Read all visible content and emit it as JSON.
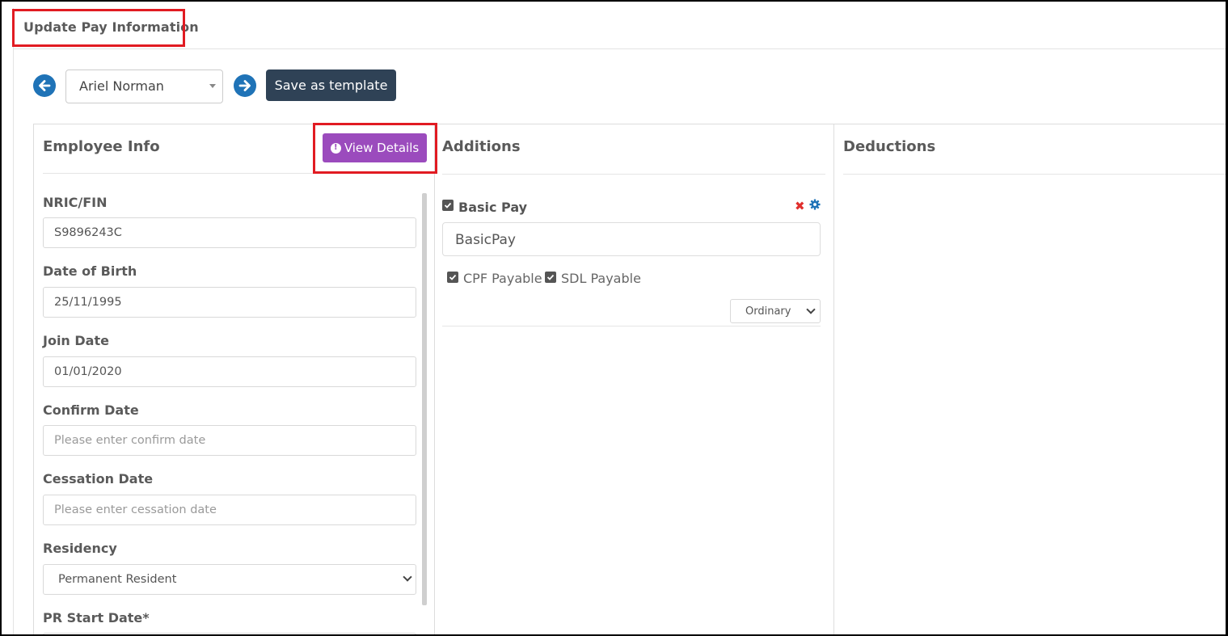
{
  "header": {
    "title": "Update Pay Information"
  },
  "toolbar": {
    "prev_icon": "arrow-left-circle-icon",
    "next_icon": "arrow-right-circle-icon",
    "employee_selected": "Ariel Norman",
    "save_template_label": "Save as template"
  },
  "employee_info": {
    "title": "Employee Info",
    "view_details_label": "View Details",
    "fields": {
      "nric": {
        "label": "NRIC/FIN",
        "value": "S9896243C"
      },
      "dob": {
        "label": "Date of Birth",
        "value": "25/11/1995"
      },
      "join_date": {
        "label": "Join Date",
        "value": "01/01/2020"
      },
      "confirm_date": {
        "label": "Confirm Date",
        "placeholder": "Please enter confirm date"
      },
      "cessation_date": {
        "label": "Cessation Date",
        "placeholder": "Please enter cessation date"
      },
      "residency": {
        "label": "Residency",
        "value": "Permanent Resident"
      },
      "pr_start_date": {
        "label": "PR Start Date*"
      }
    }
  },
  "additions": {
    "title": "Additions",
    "items": [
      {
        "name": "Basic Pay",
        "checked": true,
        "value": "BasicPay",
        "cpf_label": "CPF Payable",
        "cpf_checked": true,
        "sdl_label": "SDL Payable",
        "sdl_checked": true,
        "type": "Ordinary"
      }
    ]
  },
  "deductions": {
    "title": "Deductions"
  },
  "colors": {
    "primary": "#1f73b7",
    "save_button": "#2f4256",
    "view_details": "#9b4bbd",
    "highlight": "#e11b22",
    "delete": "#e0302e"
  }
}
